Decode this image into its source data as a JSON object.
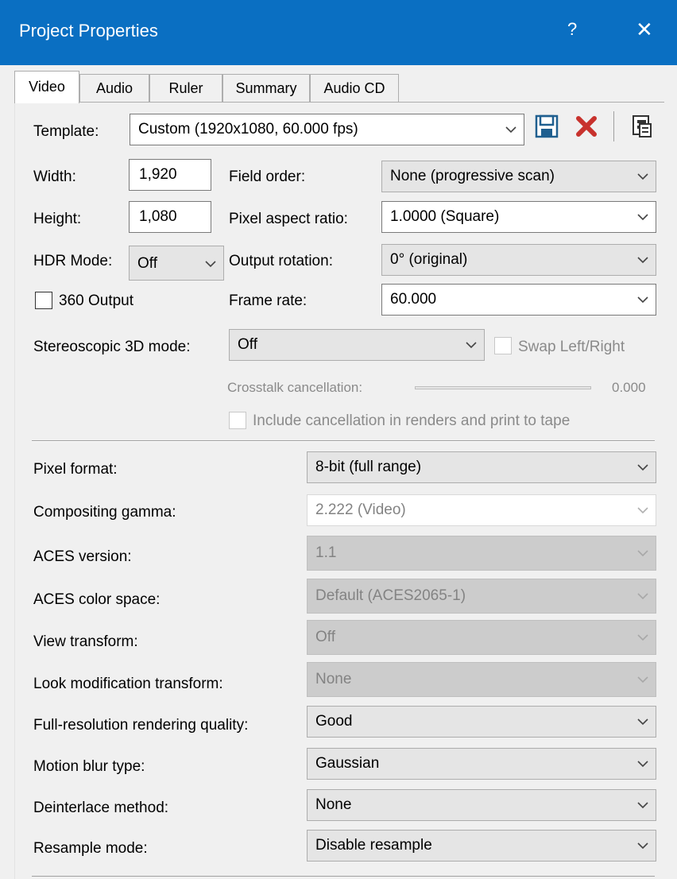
{
  "window": {
    "title": "Project Properties",
    "help": "?",
    "close": "✕"
  },
  "tabs": [
    "Video",
    "Audio",
    "Ruler",
    "Summary",
    "Audio CD"
  ],
  "template": {
    "label": "Template:",
    "value": "Custom (1920x1080, 60.000 fps)"
  },
  "width": {
    "label": "Width:",
    "value": "1,920"
  },
  "height": {
    "label": "Height:",
    "value": "1,080"
  },
  "hdr": {
    "label": "HDR Mode:",
    "value": "Off"
  },
  "output360": {
    "label": "360 Output",
    "checked": false
  },
  "field_order": {
    "label": "Field order:",
    "value": "None (progressive scan)"
  },
  "pixel_aspect": {
    "label": "Pixel aspect ratio:",
    "value": "1.0000 (Square)"
  },
  "output_rotation": {
    "label": "Output rotation:",
    "value": "0° (original)"
  },
  "frame_rate": {
    "label": "Frame rate:",
    "value": "60.000"
  },
  "stereo": {
    "label": "Stereoscopic 3D mode:",
    "value": "Off",
    "swap_label": "Swap Left/Right"
  },
  "crosstalk": {
    "label": "Crosstalk cancellation:",
    "value": "0.000"
  },
  "include_cancel": {
    "label": "Include cancellation in renders and print to tape"
  },
  "pixel_format": {
    "label": "Pixel format:",
    "value": "8-bit (full range)"
  },
  "compositing_gamma": {
    "label": "Compositing gamma:",
    "value": "2.222 (Video)"
  },
  "aces_version": {
    "label": "ACES version:",
    "value": "1.1"
  },
  "aces_color_space": {
    "label": "ACES color space:",
    "value": "Default (ACES2065-1)"
  },
  "view_transform": {
    "label": "View transform:",
    "value": "Off"
  },
  "look_mod": {
    "label": "Look modification transform:",
    "value": "None"
  },
  "full_res": {
    "label": "Full-resolution rendering quality:",
    "value": "Good"
  },
  "motion_blur": {
    "label": "Motion blur type:",
    "value": "Gaussian"
  },
  "deinterlace": {
    "label": "Deinterlace method:",
    "value": "None"
  },
  "resample": {
    "label": "Resample mode:",
    "value": "Disable resample"
  },
  "icons": [
    "save-icon",
    "delete-icon",
    "copy-icon"
  ],
  "colors": {
    "titlebar": "#0a6fc2",
    "window_bg": "#f0f0f0",
    "delete_red": "#c8322d",
    "save_blue": "#1f5f8f"
  }
}
